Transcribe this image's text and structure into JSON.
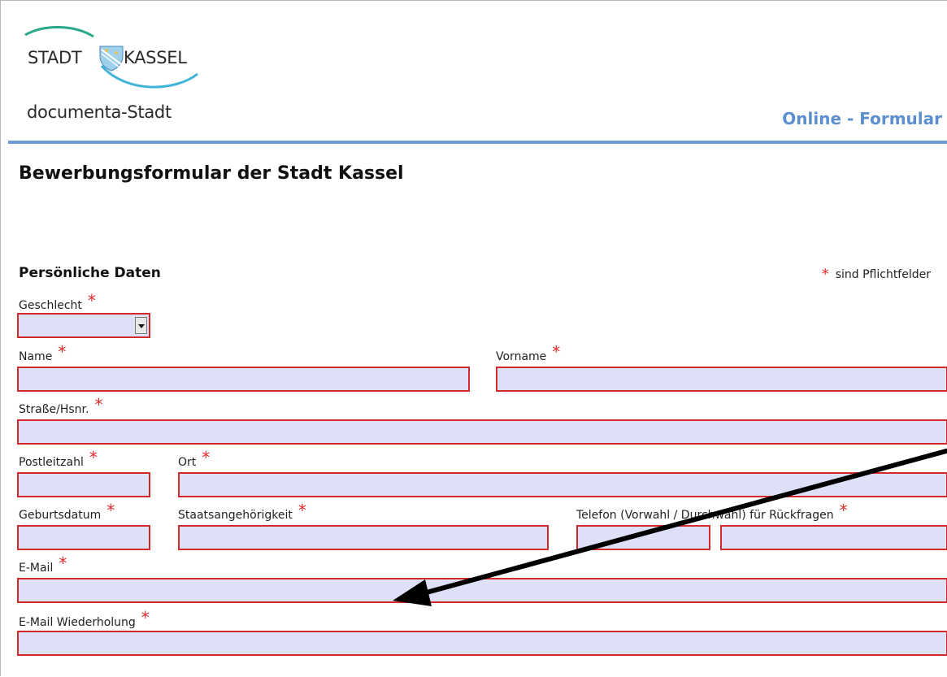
{
  "header": {
    "brand_left": "STADT",
    "brand_right": "KASSEL",
    "subtitle": "documenta-Stadt",
    "online_label": "Online - Formular"
  },
  "page_title": "Bewerbungsformular der Stadt Kassel",
  "section": {
    "title": "Persönliche Daten",
    "required_note": "sind Pflichtfelder",
    "required_marker": "*"
  },
  "fields": {
    "gender": {
      "label": "Geschlecht",
      "value": ""
    },
    "last_name": {
      "label": "Name",
      "value": ""
    },
    "first_name": {
      "label": "Vorname",
      "value": ""
    },
    "street": {
      "label": "Straße/Hsnr.",
      "value": ""
    },
    "zip": {
      "label": "Postleitzahl",
      "value": ""
    },
    "city": {
      "label": "Ort",
      "value": ""
    },
    "birthdate": {
      "label": "Geburtsdatum",
      "value": ""
    },
    "nationality": {
      "label": "Staatsangehörigkeit",
      "value": ""
    },
    "phone": {
      "label": "Telefon (Vorwahl / Durchwahl) für Rückfragen",
      "area_code": "",
      "number": ""
    },
    "email": {
      "label": "E-Mail",
      "value": ""
    },
    "email_repeat": {
      "label": "E-Mail Wiederholung",
      "value": ""
    }
  },
  "colors": {
    "required": "#e02a2a",
    "field_border": "#d22a2a",
    "field_fill": "#dde0f7",
    "accent": "#5b8fcf"
  },
  "icons": [
    "kassel-coat-of-arms-icon",
    "callout-arrow-icon",
    "dropdown-arrow-icon"
  ]
}
